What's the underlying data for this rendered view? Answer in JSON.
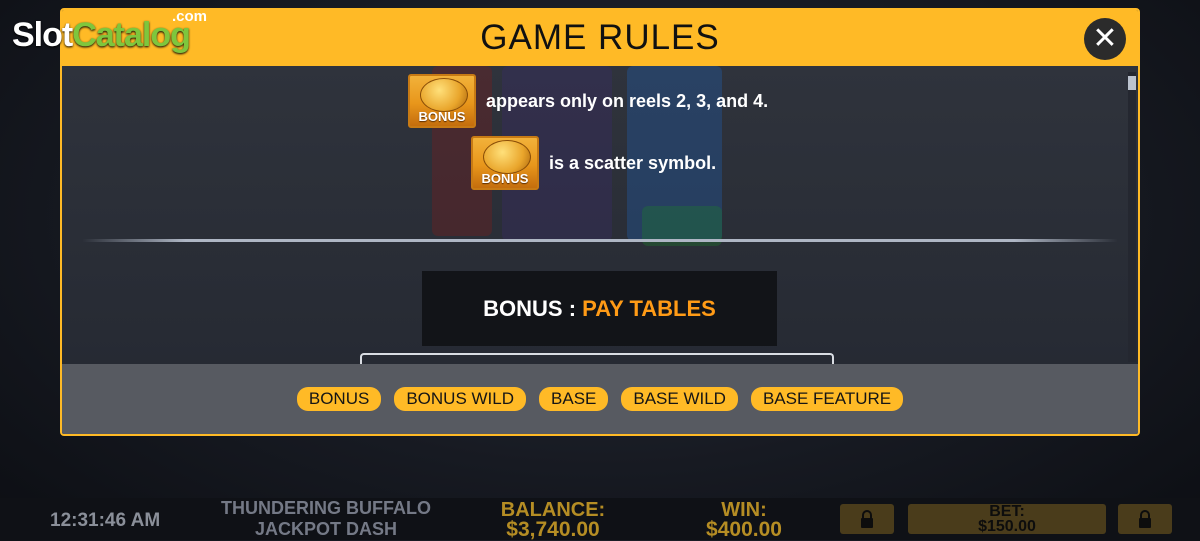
{
  "logo": {
    "slot": "Slot",
    "catalog": "Catalog",
    "dotcom": ".com"
  },
  "modal": {
    "title": "GAME RULES",
    "close_label": "✕",
    "rules": [
      {
        "symbol": "BONUS",
        "text": "appears only on reels 2, 3, and 4."
      },
      {
        "symbol": "BONUS",
        "text": "is a scatter symbol."
      }
    ],
    "section": {
      "label": "BONUS",
      "separator": " : ",
      "highlight": "PAY TABLES"
    },
    "tabs": [
      {
        "label": "BONUS"
      },
      {
        "label": "BONUS WILD"
      },
      {
        "label": "BASE"
      },
      {
        "label": "BASE WILD"
      },
      {
        "label": "BASE FEATURE"
      }
    ]
  },
  "footer": {
    "clock": "12:31:46 AM",
    "game_line1": "THUNDERING BUFFALO",
    "game_line2": "JACKPOT DASH",
    "balance_label": "BALANCE:",
    "balance_value": "$3,740.00",
    "win_label": "WIN:",
    "win_value": "$400.00",
    "bet_label": "BET:",
    "bet_value": "$150.00"
  },
  "colors": {
    "accent": "#ffba26",
    "highlight": "#ff9b16",
    "tab_bar": "#575a61",
    "footer_gold": "#b58d24"
  },
  "icons": {
    "close": "close-icon",
    "lock": "lock-icon",
    "bonus_symbol": "buffalo-coin-icon"
  }
}
